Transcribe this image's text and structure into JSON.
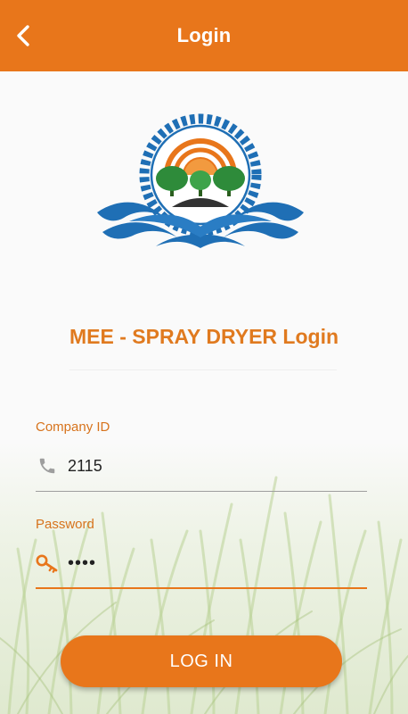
{
  "appbar": {
    "title": "Login",
    "back_icon": "chevron-left-icon"
  },
  "heading": "MEE - SPRAY DRYER Login",
  "company_id": {
    "label": "Company ID",
    "value": "2115",
    "icon": "phone-icon"
  },
  "password": {
    "label": "Password",
    "value": "••••",
    "icon": "key-icon"
  },
  "login_button": "LOG IN",
  "colors": {
    "accent": "#e8761b",
    "label": "#d7731c",
    "logo_blue": "#1f6fb5",
    "logo_green": "#2e8b3a"
  }
}
